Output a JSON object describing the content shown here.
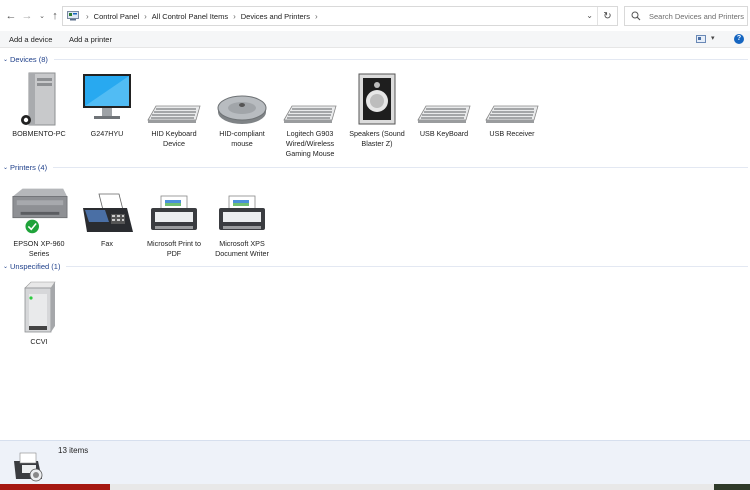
{
  "nav": {
    "back_icon": "back-arrow-icon",
    "forward_icon": "forward-arrow-icon",
    "recent_icon": "chevron-down-icon",
    "up_icon": "up-arrow-icon"
  },
  "address": {
    "crumbs": [
      "Control Panel",
      "All Control Panel Items",
      "Devices and Printers"
    ],
    "refresh_icon": "refresh-icon"
  },
  "search": {
    "placeholder": "Search Devices and Printers"
  },
  "toolbar": {
    "add_device": "Add a device",
    "add_printer": "Add a printer",
    "help": "?"
  },
  "groups": {
    "devices": {
      "label": "Devices (8)",
      "items": [
        {
          "name": "BOBMENTO-PC",
          "icon": "pc-tower-icon"
        },
        {
          "name": "G247HYU",
          "icon": "monitor-icon"
        },
        {
          "name": "HID Keyboard Device",
          "icon": "keyboard-icon"
        },
        {
          "name": "HID-compliant mouse",
          "icon": "mouse-icon"
        },
        {
          "name": "Logitech G903 Wired/Wireless Gaming Mouse",
          "icon": "keyboard-icon"
        },
        {
          "name": "Speakers (Sound Blaster Z)",
          "icon": "speaker-icon"
        },
        {
          "name": "USB KeyBoard",
          "icon": "keyboard-icon"
        },
        {
          "name": "USB Receiver",
          "icon": "keyboard-icon"
        }
      ]
    },
    "printers": {
      "label": "Printers (4)",
      "items": [
        {
          "name": "EPSON XP-960 Series",
          "icon": "printer-icon"
        },
        {
          "name": "Fax",
          "icon": "fax-icon"
        },
        {
          "name": "Microsoft Print to PDF",
          "icon": "virtual-printer-icon"
        },
        {
          "name": "Microsoft XPS Document Writer",
          "icon": "virtual-printer-icon"
        }
      ]
    },
    "unspecified": {
      "label": "Unspecified (1)",
      "items": [
        {
          "name": "CCVI",
          "icon": "server-box-icon"
        }
      ]
    }
  },
  "status": {
    "count": "13 items"
  }
}
